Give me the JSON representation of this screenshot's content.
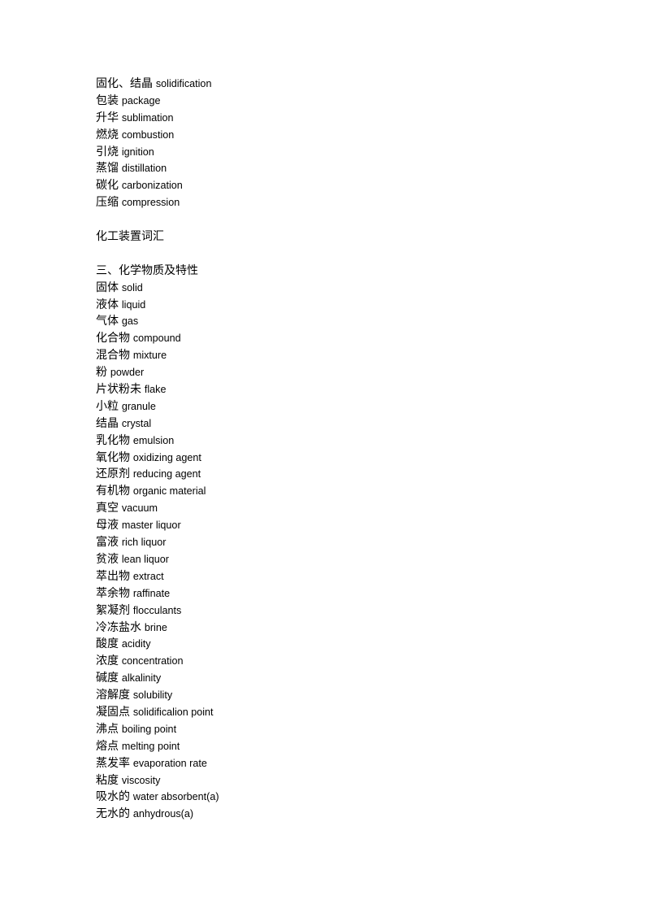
{
  "document": {
    "background_color": "#ffffff",
    "text_color": "#000000",
    "blocks": [
      {
        "type": "entries",
        "entries": [
          {
            "zh": "固化、结晶",
            "en": "solidification"
          },
          {
            "zh": "包装",
            "en": "package"
          },
          {
            "zh": "升华",
            "en": "sublimation"
          },
          {
            "zh": "燃烧",
            "en": "combustion"
          },
          {
            "zh": "引烧",
            "en": "ignition"
          },
          {
            "zh": "蒸馏",
            "en": "distillation"
          },
          {
            "zh": "碳化",
            "en": "carbonization"
          },
          {
            "zh": "压缩",
            "en": "compression"
          }
        ]
      },
      {
        "type": "spacer"
      },
      {
        "type": "heading",
        "text": "化工装置词汇"
      },
      {
        "type": "spacer"
      },
      {
        "type": "heading",
        "text": "三、化学物质及特性"
      },
      {
        "type": "entries",
        "entries": [
          {
            "zh": "固体",
            "en": "solid"
          },
          {
            "zh": "液体",
            "en": "liquid"
          },
          {
            "zh": "气体",
            "en": "gas"
          },
          {
            "zh": "化合物",
            "en": "compound"
          },
          {
            "zh": "混合物",
            "en": "mixture"
          },
          {
            "zh": "粉",
            "en": "powder"
          },
          {
            "zh": "片状粉未",
            "en": "flake"
          },
          {
            "zh": "小粒",
            "en": "granule"
          },
          {
            "zh": "结晶",
            "en": "crystal"
          },
          {
            "zh": "乳化物",
            "en": "emulsion"
          },
          {
            "zh": "氧化物",
            "en": "oxidizing agent"
          },
          {
            "zh": "还原剂",
            "en": "reducing agent"
          },
          {
            "zh": "有机物",
            "en": "organic material"
          },
          {
            "zh": "真空",
            "en": "vacuum"
          },
          {
            "zh": "母液",
            "en": "master liquor"
          },
          {
            "zh": "富液",
            "en": "rich liquor"
          },
          {
            "zh": "贫液",
            "en": "lean liquor"
          },
          {
            "zh": "萃出物",
            "en": "extract"
          },
          {
            "zh": "萃余物",
            "en": "raffinate"
          },
          {
            "zh": "絮凝剂",
            "en": "flocculants"
          },
          {
            "zh": "冷冻盐水",
            "en": "brine"
          },
          {
            "zh": "酸度",
            "en": "acidity"
          },
          {
            "zh": "浓度",
            "en": "concentration"
          },
          {
            "zh": "碱度",
            "en": "alkalinity"
          },
          {
            "zh": "溶解度",
            "en": "solubility"
          },
          {
            "zh": "凝固点",
            "en": "solidificalion  point"
          },
          {
            "zh": "沸点",
            "en": "boiling point"
          },
          {
            "zh": "熔点",
            "en": "melting point"
          },
          {
            "zh": "蒸发率",
            "en": "evaporation rate"
          },
          {
            "zh": "粘度",
            "en": "viscosity"
          },
          {
            "zh": "吸水的",
            "en": "water absorbent(a)"
          },
          {
            "zh": "无水的",
            "en": "anhydrous(a)"
          }
        ]
      }
    ]
  }
}
